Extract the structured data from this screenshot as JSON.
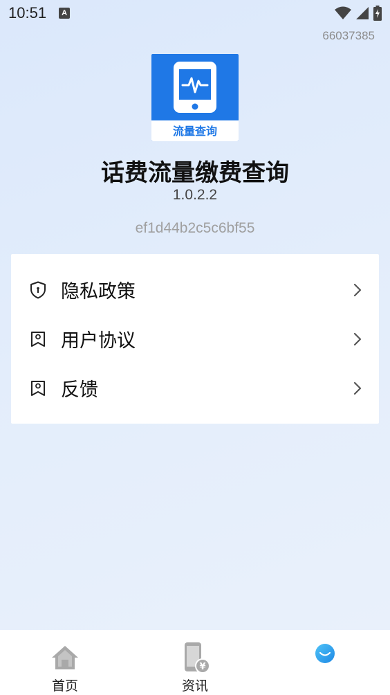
{
  "status_bar": {
    "time": "10:51",
    "notification_icon": "a-icon",
    "icons": [
      "wifi-icon",
      "signal-icon",
      "battery-icon"
    ]
  },
  "header": {
    "user_id": "66037385"
  },
  "app": {
    "logo_label": "流量查询",
    "name": "话费流量缴费查询",
    "version": "1.0.2.2",
    "device_hash": "ef1d44b2c5c6bf55"
  },
  "menu": {
    "items": [
      {
        "label": "隐私政策",
        "icon": "shield-icon"
      },
      {
        "label": "用户协议",
        "icon": "document-icon"
      },
      {
        "label": "反馈",
        "icon": "document-icon"
      }
    ]
  },
  "tab_bar": {
    "tabs": [
      {
        "label": "首页",
        "icon": "home-icon"
      },
      {
        "label": "资讯",
        "icon": "phone-yuan-icon"
      },
      {
        "label": "",
        "icon": "smile-icon",
        "active": true
      }
    ]
  },
  "colors": {
    "brand_blue": "#1f78e6",
    "active_tab": "#29a8f0",
    "inactive_icon": "#a9a9a9"
  }
}
